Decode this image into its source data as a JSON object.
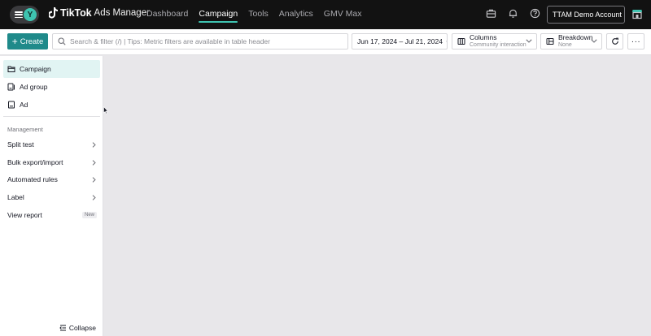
{
  "app": {
    "avatar_initial": "Y",
    "brand": "TikTok",
    "product": "Ads Manager",
    "accent_color": "#3ec3b0"
  },
  "nav": {
    "items": [
      {
        "label": "Dashboard",
        "active": false
      },
      {
        "label": "Campaign",
        "active": true
      },
      {
        "label": "Tools",
        "active": false
      },
      {
        "label": "Analytics",
        "active": false
      },
      {
        "label": "GMV Max",
        "active": false
      }
    ]
  },
  "header_icons": [
    "briefcase-icon",
    "bell-icon",
    "help-icon",
    "shop-icon"
  ],
  "account": {
    "label": "TTAM Demo Account"
  },
  "toolbar": {
    "create_label": "Create",
    "search_placeholder": "Search & filter (/) | Tips: Metric filters are available in table header",
    "date_range": "Jun 17, 2024 – Jul 21, 2024",
    "columns_label": "Columns",
    "columns_value": "Community interaction",
    "breakdown_label": "Breakdown",
    "breakdown_value": "None",
    "more_label": "···",
    "primary_color": "#1f8a8a"
  },
  "sidebar": {
    "levels": [
      {
        "label": "Campaign",
        "icon": "folder-icon",
        "active": true
      },
      {
        "label": "Ad group",
        "icon": "ad-group-icon",
        "active": false
      },
      {
        "label": "Ad",
        "icon": "ad-icon",
        "active": false
      }
    ],
    "section_label": "Management",
    "management": [
      {
        "label": "Split test",
        "has_arrow": true
      },
      {
        "label": "Bulk export/import",
        "has_arrow": true
      },
      {
        "label": "Automated rules",
        "has_arrow": true
      },
      {
        "label": "Label",
        "has_arrow": true
      },
      {
        "label": "View report",
        "badge": "New"
      }
    ],
    "collapse_label": "Collapse"
  }
}
